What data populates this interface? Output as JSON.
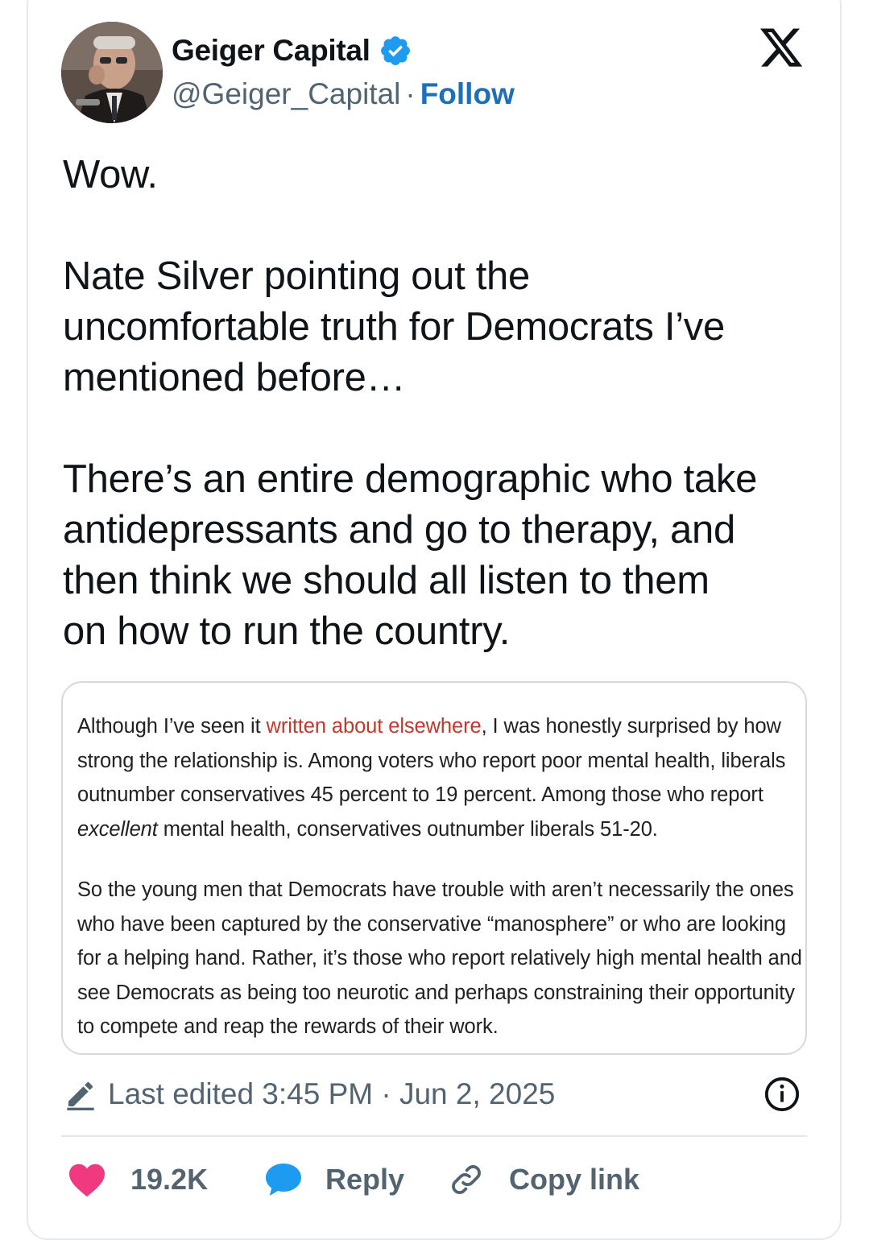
{
  "author": {
    "name": "Geiger Capital",
    "handle": "@Geiger_Capital",
    "separator": "·",
    "follow_label": "Follow",
    "verified": true
  },
  "tweet": {
    "paragraphs": [
      "Wow.",
      "Nate Silver pointing out the\nuncomfortable truth for Democrats I’ve\nmentioned before…",
      "There’s an entire demographic who take\nantidepressants and go to therapy, and\nthen think we should all listen to them\non how to run the country."
    ]
  },
  "quote": {
    "para1": {
      "pre": "Although I’ve seen it ",
      "link": "written about elsewhere",
      "mid": ", I was honestly surprised by how strong the relationship is. Among voters who report poor mental health, liberals outnumber conservatives 45 percent to 19 percent. Among those who report ",
      "emph": "excellent",
      "post": " mental health, conservatives outnumber liberals 51-20."
    },
    "para2": "So the young men that Democrats have trouble with aren’t necessarily the ones who have been captured by the conservative “manosphere” or who are looking for a helping hand. Rather, it’s those who report relatively high mental health and see Democrats as being too neurotic and perhaps constraining their opportunity to compete and reap the rewards of their work."
  },
  "meta": {
    "edited_label": "Last edited 3:45 PM · Jun 2, 2025"
  },
  "actions": {
    "likes": "19.2K",
    "reply": "Reply",
    "copy_link": "Copy link"
  },
  "colors": {
    "link": "#1d6fb8",
    "quote_link": "#c0392b",
    "like": "#f0397f",
    "reply": "#1d9bf0",
    "verified": "#1d9bf0",
    "muted": "#536471"
  },
  "icons": [
    "verified-badge-icon",
    "x-logo-icon",
    "pencil-icon",
    "info-icon",
    "heart-icon",
    "reply-bubble-icon",
    "link-icon"
  ]
}
